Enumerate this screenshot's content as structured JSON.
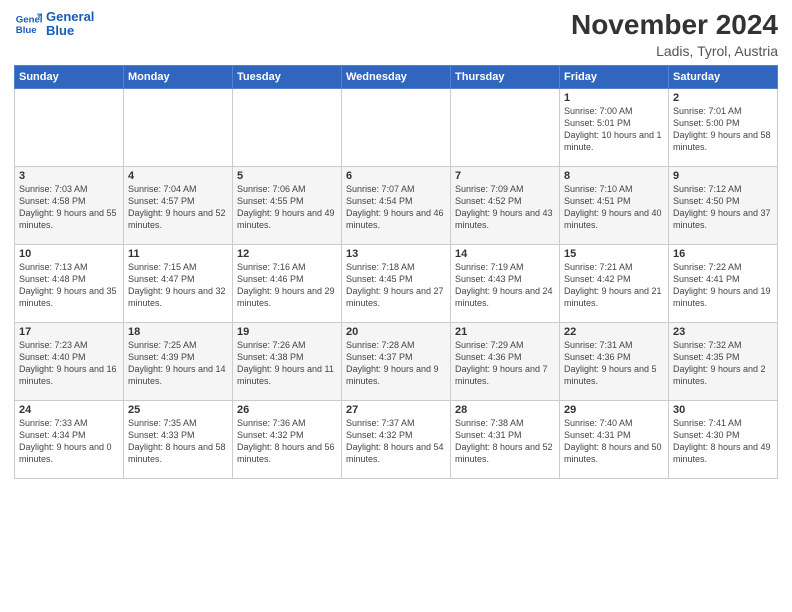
{
  "header": {
    "logo_line1": "General",
    "logo_line2": "Blue",
    "title": "November 2024",
    "subtitle": "Ladis, Tyrol, Austria"
  },
  "weekdays": [
    "Sunday",
    "Monday",
    "Tuesday",
    "Wednesday",
    "Thursday",
    "Friday",
    "Saturday"
  ],
  "weeks": [
    [
      {
        "day": "",
        "info": ""
      },
      {
        "day": "",
        "info": ""
      },
      {
        "day": "",
        "info": ""
      },
      {
        "day": "",
        "info": ""
      },
      {
        "day": "",
        "info": ""
      },
      {
        "day": "1",
        "info": "Sunrise: 7:00 AM\nSunset: 5:01 PM\nDaylight: 10 hours and 1 minute."
      },
      {
        "day": "2",
        "info": "Sunrise: 7:01 AM\nSunset: 5:00 PM\nDaylight: 9 hours and 58 minutes."
      }
    ],
    [
      {
        "day": "3",
        "info": "Sunrise: 7:03 AM\nSunset: 4:58 PM\nDaylight: 9 hours and 55 minutes."
      },
      {
        "day": "4",
        "info": "Sunrise: 7:04 AM\nSunset: 4:57 PM\nDaylight: 9 hours and 52 minutes."
      },
      {
        "day": "5",
        "info": "Sunrise: 7:06 AM\nSunset: 4:55 PM\nDaylight: 9 hours and 49 minutes."
      },
      {
        "day": "6",
        "info": "Sunrise: 7:07 AM\nSunset: 4:54 PM\nDaylight: 9 hours and 46 minutes."
      },
      {
        "day": "7",
        "info": "Sunrise: 7:09 AM\nSunset: 4:52 PM\nDaylight: 9 hours and 43 minutes."
      },
      {
        "day": "8",
        "info": "Sunrise: 7:10 AM\nSunset: 4:51 PM\nDaylight: 9 hours and 40 minutes."
      },
      {
        "day": "9",
        "info": "Sunrise: 7:12 AM\nSunset: 4:50 PM\nDaylight: 9 hours and 37 minutes."
      }
    ],
    [
      {
        "day": "10",
        "info": "Sunrise: 7:13 AM\nSunset: 4:48 PM\nDaylight: 9 hours and 35 minutes."
      },
      {
        "day": "11",
        "info": "Sunrise: 7:15 AM\nSunset: 4:47 PM\nDaylight: 9 hours and 32 minutes."
      },
      {
        "day": "12",
        "info": "Sunrise: 7:16 AM\nSunset: 4:46 PM\nDaylight: 9 hours and 29 minutes."
      },
      {
        "day": "13",
        "info": "Sunrise: 7:18 AM\nSunset: 4:45 PM\nDaylight: 9 hours and 27 minutes."
      },
      {
        "day": "14",
        "info": "Sunrise: 7:19 AM\nSunset: 4:43 PM\nDaylight: 9 hours and 24 minutes."
      },
      {
        "day": "15",
        "info": "Sunrise: 7:21 AM\nSunset: 4:42 PM\nDaylight: 9 hours and 21 minutes."
      },
      {
        "day": "16",
        "info": "Sunrise: 7:22 AM\nSunset: 4:41 PM\nDaylight: 9 hours and 19 minutes."
      }
    ],
    [
      {
        "day": "17",
        "info": "Sunrise: 7:23 AM\nSunset: 4:40 PM\nDaylight: 9 hours and 16 minutes."
      },
      {
        "day": "18",
        "info": "Sunrise: 7:25 AM\nSunset: 4:39 PM\nDaylight: 9 hours and 14 minutes."
      },
      {
        "day": "19",
        "info": "Sunrise: 7:26 AM\nSunset: 4:38 PM\nDaylight: 9 hours and 11 minutes."
      },
      {
        "day": "20",
        "info": "Sunrise: 7:28 AM\nSunset: 4:37 PM\nDaylight: 9 hours and 9 minutes."
      },
      {
        "day": "21",
        "info": "Sunrise: 7:29 AM\nSunset: 4:36 PM\nDaylight: 9 hours and 7 minutes."
      },
      {
        "day": "22",
        "info": "Sunrise: 7:31 AM\nSunset: 4:36 PM\nDaylight: 9 hours and 5 minutes."
      },
      {
        "day": "23",
        "info": "Sunrise: 7:32 AM\nSunset: 4:35 PM\nDaylight: 9 hours and 2 minutes."
      }
    ],
    [
      {
        "day": "24",
        "info": "Sunrise: 7:33 AM\nSunset: 4:34 PM\nDaylight: 9 hours and 0 minutes."
      },
      {
        "day": "25",
        "info": "Sunrise: 7:35 AM\nSunset: 4:33 PM\nDaylight: 8 hours and 58 minutes."
      },
      {
        "day": "26",
        "info": "Sunrise: 7:36 AM\nSunset: 4:32 PM\nDaylight: 8 hours and 56 minutes."
      },
      {
        "day": "27",
        "info": "Sunrise: 7:37 AM\nSunset: 4:32 PM\nDaylight: 8 hours and 54 minutes."
      },
      {
        "day": "28",
        "info": "Sunrise: 7:38 AM\nSunset: 4:31 PM\nDaylight: 8 hours and 52 minutes."
      },
      {
        "day": "29",
        "info": "Sunrise: 7:40 AM\nSunset: 4:31 PM\nDaylight: 8 hours and 50 minutes."
      },
      {
        "day": "30",
        "info": "Sunrise: 7:41 AM\nSunset: 4:30 PM\nDaylight: 8 hours and 49 minutes."
      }
    ]
  ]
}
